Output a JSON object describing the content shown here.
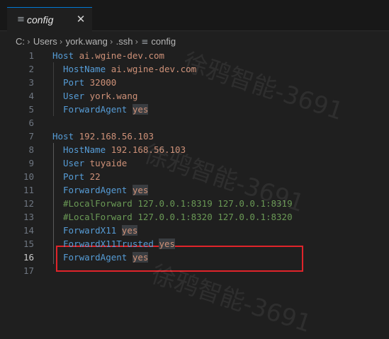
{
  "tab": {
    "icon": "≡",
    "label": "config",
    "close": "✕"
  },
  "breadcrumb": {
    "items": [
      "C:",
      "Users",
      "york.wang",
      ".ssh"
    ],
    "file_icon": "≡",
    "file": "config"
  },
  "watermark": "徐鸦智能-3691",
  "editor": {
    "lines": [
      {
        "num": "1",
        "indent": false,
        "key": "Host",
        "value": "ai.wgine-dev.com"
      },
      {
        "num": "2",
        "indent": true,
        "key": "HostName",
        "value": "ai.wgine-dev.com"
      },
      {
        "num": "3",
        "indent": true,
        "key": "Port",
        "value": "32000"
      },
      {
        "num": "4",
        "indent": true,
        "key": "User",
        "value": "york.wang"
      },
      {
        "num": "5",
        "indent": true,
        "key": "ForwardAgent",
        "value": "yes"
      },
      {
        "num": "6",
        "indent": false,
        "key": "",
        "value": ""
      },
      {
        "num": "7",
        "indent": false,
        "key": "Host",
        "value": "192.168.56.103"
      },
      {
        "num": "8",
        "indent": true,
        "key": "HostName",
        "value": "192.168.56.103"
      },
      {
        "num": "9",
        "indent": true,
        "key": "User",
        "value": "tuyaide"
      },
      {
        "num": "10",
        "indent": true,
        "key": "Port",
        "value": "22"
      },
      {
        "num": "11",
        "indent": true,
        "key": "ForwardAgent",
        "value": "yes"
      },
      {
        "num": "12",
        "indent": true,
        "comment": "#LocalForward 127.0.0.1:8319 127.0.0.1:8319"
      },
      {
        "num": "13",
        "indent": true,
        "comment": "#LocalForward 127.0.0.1:8320 127.0.0.1:8320"
      },
      {
        "num": "14",
        "indent": true,
        "key": "ForwardX11",
        "value": "yes"
      },
      {
        "num": "15",
        "indent": true,
        "key": "ForwardX11Trusted",
        "value": "yes"
      },
      {
        "num": "16",
        "indent": true,
        "key": "ForwardAgent",
        "value": "yes"
      },
      {
        "num": "17",
        "indent": false,
        "key": "",
        "value": ""
      }
    ],
    "active_line": "16"
  },
  "colors": {
    "keyword": "#569cd6",
    "value": "#ce9178",
    "comment": "#6a9955",
    "highlight_box": "#e0242a"
  }
}
